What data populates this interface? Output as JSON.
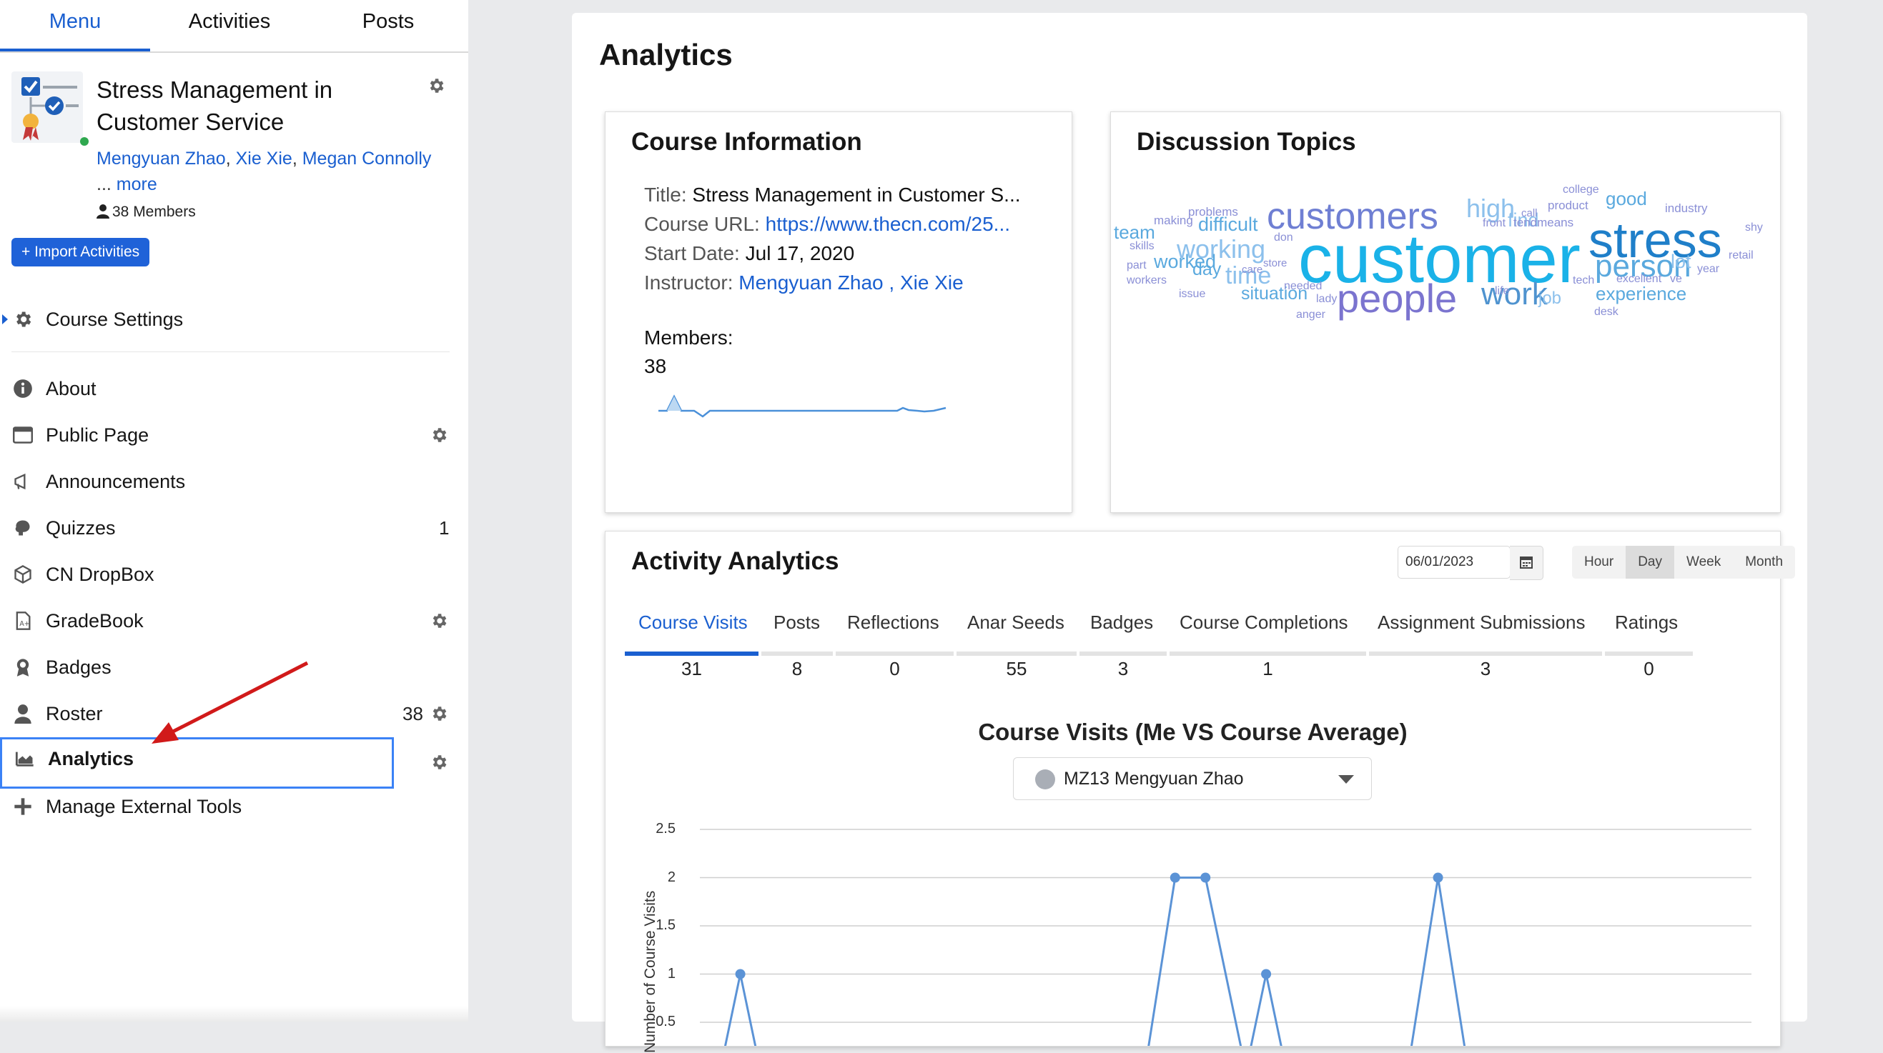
{
  "sidebar": {
    "tabs": [
      {
        "label": "Menu",
        "active": true
      },
      {
        "label": "Activities",
        "active": false
      },
      {
        "label": "Posts",
        "active": false
      }
    ],
    "course": {
      "title": "Stress Management in Customer Service",
      "instructors": [
        "Mengyuan Zhao",
        "Xie Xie",
        "Megan Connolly"
      ],
      "more_label": "... more",
      "more_link": "more",
      "members_text": "38 Members"
    },
    "import_button": "+ Import Activities",
    "course_settings": "Course Settings",
    "items": [
      {
        "label": "About",
        "icon": "info-icon"
      },
      {
        "label": "Public Page",
        "icon": "browser-window-icon"
      },
      {
        "label": "Announcements",
        "icon": "megaphone-icon"
      },
      {
        "label": "Quizzes",
        "icon": "brain-icon",
        "count": "1"
      },
      {
        "label": "CN DropBox",
        "icon": "box-icon"
      },
      {
        "label": "GradeBook",
        "icon": "gradebook-icon"
      },
      {
        "label": "Badges",
        "icon": "badge-icon"
      },
      {
        "label": "Roster",
        "icon": "user-icon",
        "count": "38"
      },
      {
        "label": "Analytics",
        "icon": "area-chart-icon",
        "active": true
      },
      {
        "label": "Manage External Tools",
        "icon": "plus-icon"
      }
    ]
  },
  "main": {
    "title": "Analytics",
    "course_info": {
      "title": "Course Information",
      "title_label": "Title:",
      "title_value": "Stress Management in Customer S...",
      "url_label": "Course URL:",
      "url_value": "https://www.thecn.com/25...",
      "start_label": "Start Date:",
      "start_value": "Jul 17, 2020",
      "instructor_label": "Instructor:",
      "instructor_value": "Mengyuan Zhao , Xie Xie",
      "members_label": "Members:",
      "members_value": "38",
      "sparkline_color": "#4a90d9"
    },
    "discussion": {
      "title": "Discussion Topics",
      "words": [
        {
          "text": "customer",
          "color": "#1ab2e8"
        },
        {
          "text": "stress",
          "color": "#1f7fc9"
        },
        {
          "text": "customers",
          "color": "#6f7fd3"
        },
        {
          "text": "people",
          "color": "#7b74cf"
        },
        {
          "text": "person",
          "color": "#5aa9de"
        },
        {
          "text": "work",
          "color": "#4f93cf"
        },
        {
          "text": "working",
          "color": "#8cc0ec"
        },
        {
          "text": "high",
          "color": "#8cc0ec"
        },
        {
          "text": "time",
          "color": "#8cc0ec"
        },
        {
          "text": "experience",
          "color": "#5aa9de"
        },
        {
          "text": "difficult",
          "color": "#5aa9de"
        },
        {
          "text": "worked",
          "color": "#5aa9de"
        },
        {
          "text": "situation",
          "color": "#5aa9de"
        },
        {
          "text": "good",
          "color": "#5aa9de"
        },
        {
          "text": "team",
          "color": "#5aa9de"
        },
        {
          "text": "find",
          "color": "#8cc0ec"
        },
        {
          "text": "day",
          "color": "#5aa9de"
        },
        {
          "text": "job",
          "color": "#8cc0ec"
        },
        {
          "text": "lot",
          "color": "#8cc0ec"
        },
        {
          "text": "problems",
          "color": "#8a8fd6"
        },
        {
          "text": "making",
          "color": "#8a8fd6"
        },
        {
          "text": "college",
          "color": "#8a8fd6"
        },
        {
          "text": "product",
          "color": "#8a8fd6"
        },
        {
          "text": "call",
          "color": "#8a8fd6"
        },
        {
          "text": "front",
          "color": "#8a8fd6"
        },
        {
          "text": "tendmeans",
          "color": "#8a8fd6"
        },
        {
          "text": "industry",
          "color": "#8a8fd6"
        },
        {
          "text": "shy",
          "color": "#8a8fd6"
        },
        {
          "text": "skills",
          "color": "#8a8fd6"
        },
        {
          "text": "don",
          "color": "#8a8fd6"
        },
        {
          "text": "retail",
          "color": "#8a8fd6"
        },
        {
          "text": "part",
          "color": "#8a8fd6"
        },
        {
          "text": "care",
          "color": "#8a8fd6"
        },
        {
          "text": "store",
          "color": "#8a8fd6"
        },
        {
          "text": "year",
          "color": "#8a8fd6"
        },
        {
          "text": "workers",
          "color": "#8a8fd6"
        },
        {
          "text": "tech",
          "color": "#8a8fd6"
        },
        {
          "text": "excellent",
          "color": "#8a8fd6"
        },
        {
          "text": "ve",
          "color": "#8a8fd6"
        },
        {
          "text": "needed",
          "color": "#8a8fd6"
        },
        {
          "text": "issue",
          "color": "#8a8fd6"
        },
        {
          "text": "life",
          "color": "#8a8fd6"
        },
        {
          "text": "lady",
          "color": "#8a8fd6"
        },
        {
          "text": "anger",
          "color": "#8a8fd6"
        },
        {
          "text": "desk",
          "color": "#8a8fd6"
        }
      ]
    },
    "activity": {
      "title": "Activity Analytics",
      "date": "06/01/2023",
      "ranges": [
        {
          "label": "Hour",
          "active": false
        },
        {
          "label": "Day",
          "active": true
        },
        {
          "label": "Week",
          "active": false
        },
        {
          "label": "Month",
          "active": false
        }
      ],
      "stats": [
        {
          "label": "Course Visits",
          "value": "31",
          "active": true
        },
        {
          "label": "Posts",
          "value": "8"
        },
        {
          "label": "Reflections",
          "value": "0"
        },
        {
          "label": "Anar Seeds",
          "value": "55"
        },
        {
          "label": "Badges",
          "value": "3"
        },
        {
          "label": "Course Completions",
          "value": "1"
        },
        {
          "label": "Assignment Submissions",
          "value": "3"
        },
        {
          "label": "Ratings",
          "value": "0"
        }
      ],
      "user_select": "MZ13 Mengyuan Zhao"
    }
  },
  "chart_data": {
    "type": "line",
    "title": "Course Visits (Me VS Course Average)",
    "ylabel": "Number of Course Visits",
    "ylim": [
      0,
      2.5
    ],
    "yticks": [
      "2.5",
      "2",
      "1.5",
      "1",
      "0.5"
    ],
    "grid": true,
    "series": [
      {
        "color": "#5b93d6",
        "points": [
          {
            "x": 0.5,
            "y": 0
          },
          {
            "x": 1,
            "y": 1
          },
          {
            "x": 1.5,
            "y": 0
          },
          {
            "x": 11,
            "y": 0
          },
          {
            "x": 11.75,
            "y": 2
          },
          {
            "x": 12.5,
            "y": 2
          },
          {
            "x": 13.5,
            "y": 0
          },
          {
            "x": 14,
            "y": 1
          },
          {
            "x": 14.5,
            "y": 0
          },
          {
            "x": 17.5,
            "y": 0
          },
          {
            "x": 18.25,
            "y": 2
          },
          {
            "x": 19,
            "y": 0
          }
        ]
      }
    ]
  }
}
